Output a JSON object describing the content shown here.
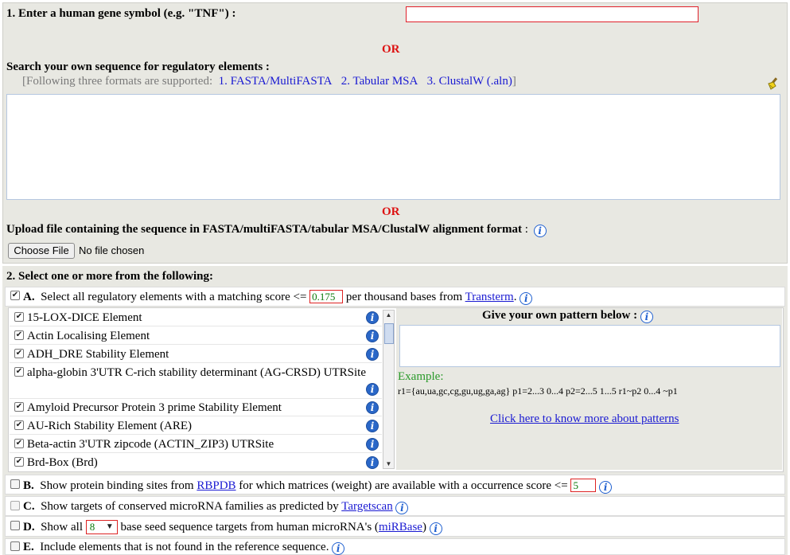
{
  "step1": {
    "gene_label": "1. Enter a human gene symbol (e.g. \"TNF\") :",
    "gene_value": "",
    "or1": "OR",
    "search_label": "Search your own sequence for regulatory elements :",
    "formats_prefix": "[Following three formats are supported:",
    "formats": [
      "1. FASTA/MultiFASTA",
      "2. Tabular MSA",
      "3. ClustalW (.aln)"
    ],
    "formats_suffix": "]",
    "clear_icon": "broom-icon",
    "sequence_value": "",
    "or2": "OR",
    "upload_label": "Upload file containing the sequence in FASTA/multiFASTA/tabular MSA/ClustalW alignment format",
    "upload_colon": ":",
    "choose_file": "Choose File",
    "no_file": "No file chosen"
  },
  "step2": {
    "heading": "2. Select one or more from the following:",
    "A": {
      "letter": "A.",
      "pre": "Select all regulatory elements with a matching score <=",
      "score": "0.175",
      "post": "per thousand bases from",
      "link": "Transterm",
      "dot": ".",
      "checked": true
    },
    "elements": [
      {
        "label": "15-LOX-DICE Element",
        "checked": true
      },
      {
        "label": "Actin Localising Element",
        "checked": true
      },
      {
        "label": "ADH_DRE Stability Element",
        "checked": true
      },
      {
        "label": "alpha-globin 3'UTR C-rich stability determinant (AG-CRSD) UTRSite",
        "checked": true
      },
      {
        "label": "Amyloid Precursor Protein 3 prime Stability Element",
        "checked": true
      },
      {
        "label": "AU-Rich Stability Element (ARE)",
        "checked": true
      },
      {
        "label": "Beta-actin 3'UTR zipcode (ACTIN_ZIP3) UTRSite",
        "checked": true
      },
      {
        "label": "Brd-Box (Brd)",
        "checked": true
      }
    ],
    "pattern": {
      "title": "Give your own pattern below :",
      "value": "",
      "example_label": "Example:",
      "example_code": "r1={au,ua,gc,cg,gu,ug,ga,ag} p1=2...3 0...4 p2=2...5 1...5 r1~p2 0...4 ~p1",
      "more_link": "Click here to know more about patterns"
    },
    "B": {
      "letter": "B.",
      "pre": "Show protein binding sites from",
      "link": "RBPDB",
      "post": "for which matrices (weight) are available with a occurrence score <=",
      "score": "5",
      "checked": false
    },
    "C": {
      "letter": "C.",
      "pre": "Show targets of conserved microRNA families as predicted by",
      "link": "Targetscan",
      "checked": false
    },
    "D": {
      "letter": "D.",
      "pre": "Show all",
      "seed": "8",
      "post": "base seed sequence targets from human microRNA's (",
      "link": "miRBase",
      "post2": ")",
      "checked": false
    },
    "E": {
      "letter": "E.",
      "text": "Include elements that is not found in the reference sequence.",
      "checked": false
    }
  },
  "colors": {
    "accent_red": "#dd1111",
    "link_blue": "#1a1ad2",
    "panel_bg": "#e8e8e2",
    "example_green": "#2a9a2a"
  }
}
